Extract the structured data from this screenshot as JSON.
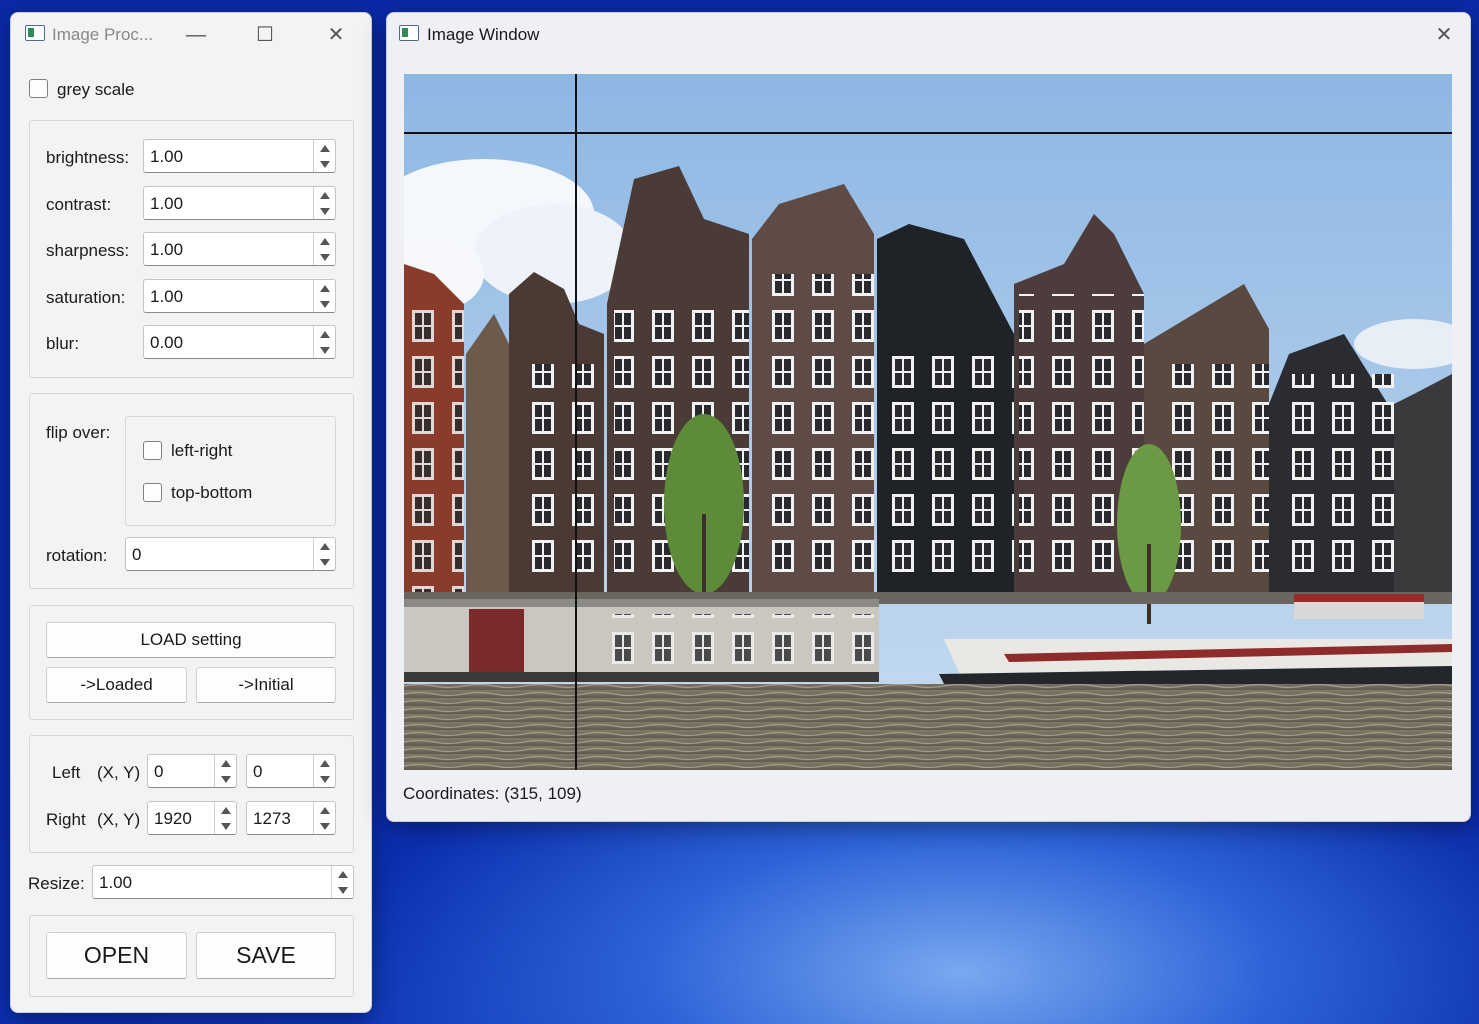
{
  "control_window": {
    "title": "Image Proc...",
    "minimize_glyph": "—",
    "maximize_glyph": "☐",
    "close_glyph": "✕",
    "grey_scale_label": "grey scale",
    "adjustments": [
      {
        "label": "brightness:",
        "value": "1.00"
      },
      {
        "label": "contrast:",
        "value": "1.00"
      },
      {
        "label": "sharpness:",
        "value": "1.00"
      },
      {
        "label": "saturation:",
        "value": "1.00"
      },
      {
        "label": "blur:",
        "value": "0.00"
      }
    ],
    "flip_over_label": "flip over:",
    "flip_options": [
      "left-right",
      "top-bottom"
    ],
    "rotation_label": "rotation:",
    "rotation_value": "0",
    "load_setting_label": "LOAD setting",
    "loaded_label": "->Loaded",
    "initial_label": "->Initial",
    "left_label": "Left",
    "right_label": "Right",
    "xy_label": "(X, Y)",
    "left_x": "0",
    "left_y": "0",
    "right_x": "1920",
    "right_y": "1273",
    "resize_label": "Resize:",
    "resize_value": "1.00",
    "open_label": "OPEN",
    "save_label": "SAVE"
  },
  "image_window": {
    "title": "Image Window",
    "close_glyph": "✕",
    "coordinates_text": "Coordinates: (315, 109)"
  },
  "icons": {
    "app": "app-window-icon",
    "photo": "amsterdam-canal-houses-photo"
  },
  "colors": {
    "desktop": "#1140c8",
    "window_bg": "#f3f3f3",
    "sky": "#a9c9ec",
    "water": "#6f6a5e"
  }
}
